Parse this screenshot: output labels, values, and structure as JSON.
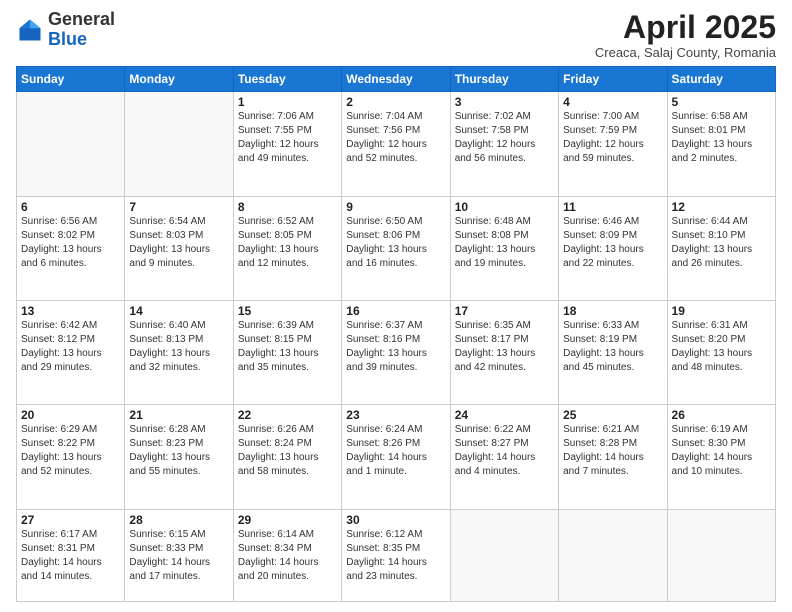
{
  "header": {
    "logo_general": "General",
    "logo_blue": "Blue",
    "month_title": "April 2025",
    "subtitle": "Creaca, Salaj County, Romania"
  },
  "days_of_week": [
    "Sunday",
    "Monday",
    "Tuesday",
    "Wednesday",
    "Thursday",
    "Friday",
    "Saturday"
  ],
  "weeks": [
    [
      {
        "day": "",
        "info": ""
      },
      {
        "day": "",
        "info": ""
      },
      {
        "day": "1",
        "info": "Sunrise: 7:06 AM\nSunset: 7:55 PM\nDaylight: 12 hours and 49 minutes."
      },
      {
        "day": "2",
        "info": "Sunrise: 7:04 AM\nSunset: 7:56 PM\nDaylight: 12 hours and 52 minutes."
      },
      {
        "day": "3",
        "info": "Sunrise: 7:02 AM\nSunset: 7:58 PM\nDaylight: 12 hours and 56 minutes."
      },
      {
        "day": "4",
        "info": "Sunrise: 7:00 AM\nSunset: 7:59 PM\nDaylight: 12 hours and 59 minutes."
      },
      {
        "day": "5",
        "info": "Sunrise: 6:58 AM\nSunset: 8:01 PM\nDaylight: 13 hours and 2 minutes."
      }
    ],
    [
      {
        "day": "6",
        "info": "Sunrise: 6:56 AM\nSunset: 8:02 PM\nDaylight: 13 hours and 6 minutes."
      },
      {
        "day": "7",
        "info": "Sunrise: 6:54 AM\nSunset: 8:03 PM\nDaylight: 13 hours and 9 minutes."
      },
      {
        "day": "8",
        "info": "Sunrise: 6:52 AM\nSunset: 8:05 PM\nDaylight: 13 hours and 12 minutes."
      },
      {
        "day": "9",
        "info": "Sunrise: 6:50 AM\nSunset: 8:06 PM\nDaylight: 13 hours and 16 minutes."
      },
      {
        "day": "10",
        "info": "Sunrise: 6:48 AM\nSunset: 8:08 PM\nDaylight: 13 hours and 19 minutes."
      },
      {
        "day": "11",
        "info": "Sunrise: 6:46 AM\nSunset: 8:09 PM\nDaylight: 13 hours and 22 minutes."
      },
      {
        "day": "12",
        "info": "Sunrise: 6:44 AM\nSunset: 8:10 PM\nDaylight: 13 hours and 26 minutes."
      }
    ],
    [
      {
        "day": "13",
        "info": "Sunrise: 6:42 AM\nSunset: 8:12 PM\nDaylight: 13 hours and 29 minutes."
      },
      {
        "day": "14",
        "info": "Sunrise: 6:40 AM\nSunset: 8:13 PM\nDaylight: 13 hours and 32 minutes."
      },
      {
        "day": "15",
        "info": "Sunrise: 6:39 AM\nSunset: 8:15 PM\nDaylight: 13 hours and 35 minutes."
      },
      {
        "day": "16",
        "info": "Sunrise: 6:37 AM\nSunset: 8:16 PM\nDaylight: 13 hours and 39 minutes."
      },
      {
        "day": "17",
        "info": "Sunrise: 6:35 AM\nSunset: 8:17 PM\nDaylight: 13 hours and 42 minutes."
      },
      {
        "day": "18",
        "info": "Sunrise: 6:33 AM\nSunset: 8:19 PM\nDaylight: 13 hours and 45 minutes."
      },
      {
        "day": "19",
        "info": "Sunrise: 6:31 AM\nSunset: 8:20 PM\nDaylight: 13 hours and 48 minutes."
      }
    ],
    [
      {
        "day": "20",
        "info": "Sunrise: 6:29 AM\nSunset: 8:22 PM\nDaylight: 13 hours and 52 minutes."
      },
      {
        "day": "21",
        "info": "Sunrise: 6:28 AM\nSunset: 8:23 PM\nDaylight: 13 hours and 55 minutes."
      },
      {
        "day": "22",
        "info": "Sunrise: 6:26 AM\nSunset: 8:24 PM\nDaylight: 13 hours and 58 minutes."
      },
      {
        "day": "23",
        "info": "Sunrise: 6:24 AM\nSunset: 8:26 PM\nDaylight: 14 hours and 1 minute."
      },
      {
        "day": "24",
        "info": "Sunrise: 6:22 AM\nSunset: 8:27 PM\nDaylight: 14 hours and 4 minutes."
      },
      {
        "day": "25",
        "info": "Sunrise: 6:21 AM\nSunset: 8:28 PM\nDaylight: 14 hours and 7 minutes."
      },
      {
        "day": "26",
        "info": "Sunrise: 6:19 AM\nSunset: 8:30 PM\nDaylight: 14 hours and 10 minutes."
      }
    ],
    [
      {
        "day": "27",
        "info": "Sunrise: 6:17 AM\nSunset: 8:31 PM\nDaylight: 14 hours and 14 minutes."
      },
      {
        "day": "28",
        "info": "Sunrise: 6:15 AM\nSunset: 8:33 PM\nDaylight: 14 hours and 17 minutes."
      },
      {
        "day": "29",
        "info": "Sunrise: 6:14 AM\nSunset: 8:34 PM\nDaylight: 14 hours and 20 minutes."
      },
      {
        "day": "30",
        "info": "Sunrise: 6:12 AM\nSunset: 8:35 PM\nDaylight: 14 hours and 23 minutes."
      },
      {
        "day": "",
        "info": ""
      },
      {
        "day": "",
        "info": ""
      },
      {
        "day": "",
        "info": ""
      }
    ]
  ]
}
